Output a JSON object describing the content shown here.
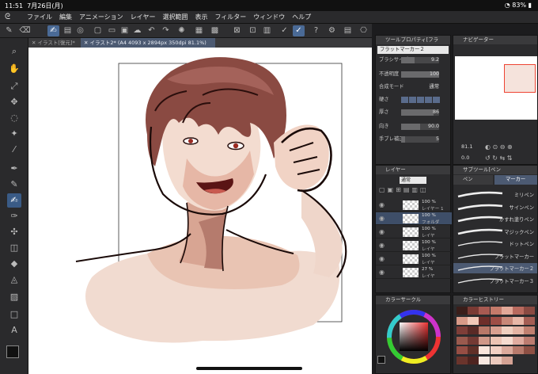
{
  "status": {
    "time": "11:51",
    "date": "7月26日(月)",
    "battery": "83%"
  },
  "menu": [
    "ファイル",
    "編集",
    "アニメーション",
    "レイヤー",
    "選択範囲",
    "表示",
    "フィルター",
    "ウィンドウ",
    "ヘルプ"
  ],
  "tabs": [
    {
      "label": "イラスト[復元]*"
    },
    {
      "label": "イラスト2* (A4 4093 x 2894px 350dpi 81.1%)"
    }
  ],
  "tool_property": {
    "title": "ツールプロパティ[フラ",
    "tool_name": "フラットマーカー２",
    "rows": [
      {
        "label": "ブラシサイズ",
        "value": "9.2",
        "fill": 0.35
      },
      {
        "label": "不透明度",
        "value": "100",
        "fill": 1.0
      },
      {
        "label": "合成モード",
        "value": "通常"
      },
      {
        "label": "硬さ",
        "value": ""
      },
      {
        "label": "厚さ",
        "value": "86",
        "fill": 0.86
      },
      {
        "label": "向き",
        "value": "90.0",
        "fill": 0.5
      },
      {
        "label": "手ブレ補正",
        "value": "5",
        "fill": 0.1
      }
    ]
  },
  "navigator": {
    "title": "ナビゲーター",
    "zoom": "81.1",
    "angle": "0.0"
  },
  "layers": {
    "title": "レイヤー",
    "blend": "通常",
    "items": [
      {
        "pct": "100 %",
        "name": "レイヤー 1"
      },
      {
        "pct": "100 %",
        "name": "フォルダ"
      },
      {
        "pct": "100 %",
        "name": "レイヤ"
      },
      {
        "pct": "100 %",
        "name": "レイヤ"
      },
      {
        "pct": "100 %",
        "name": "レイヤ"
      },
      {
        "pct": "27 %",
        "name": "レイヤ"
      }
    ]
  },
  "subtool": {
    "title": "サブツール[ペン",
    "tabs": [
      "ペン",
      "マーカー"
    ],
    "brushes": [
      "ミリペン",
      "サインペン",
      "かすれ塗りペン",
      "マジックペン",
      "ドットペン",
      "フラットマーカー",
      "フラットマーカー２",
      "フラットマーカー３"
    ],
    "selected": 6
  },
  "color_circle": {
    "title": "カラーサークル",
    "main": "#1a1a1a",
    "sub": "#ffffff"
  },
  "color_history": {
    "title": "カラーヒストリー",
    "colors": [
      "#3a1e1a",
      "#7a3a34",
      "#a85a52",
      "#c47a6a",
      "#e2a898",
      "#b86a5e",
      "#8a4a42",
      "#d89a88",
      "#f2c8b8",
      "#6e2e2a",
      "#9e4e46",
      "#c88878",
      "#e8b8a8",
      "#a45e54",
      "#7e3e38",
      "#5a2a26",
      "#b87868",
      "#d8a090",
      "#f0d0c0",
      "#e4b4a4",
      "#c08070",
      "#9a5a4e",
      "#743a34",
      "#d09888",
      "#ecc4b4",
      "#f6dcd0",
      "#e0aca0",
      "#bc7c70",
      "#964e44",
      "#603028",
      "#fae6dc",
      "#f2d0c4",
      "#dcaa9c",
      "#b87a6c",
      "#8e5044",
      "#6a342c",
      "#4e2420",
      "#f8e8e0",
      "#eccabe",
      "#d4a294"
    ]
  }
}
